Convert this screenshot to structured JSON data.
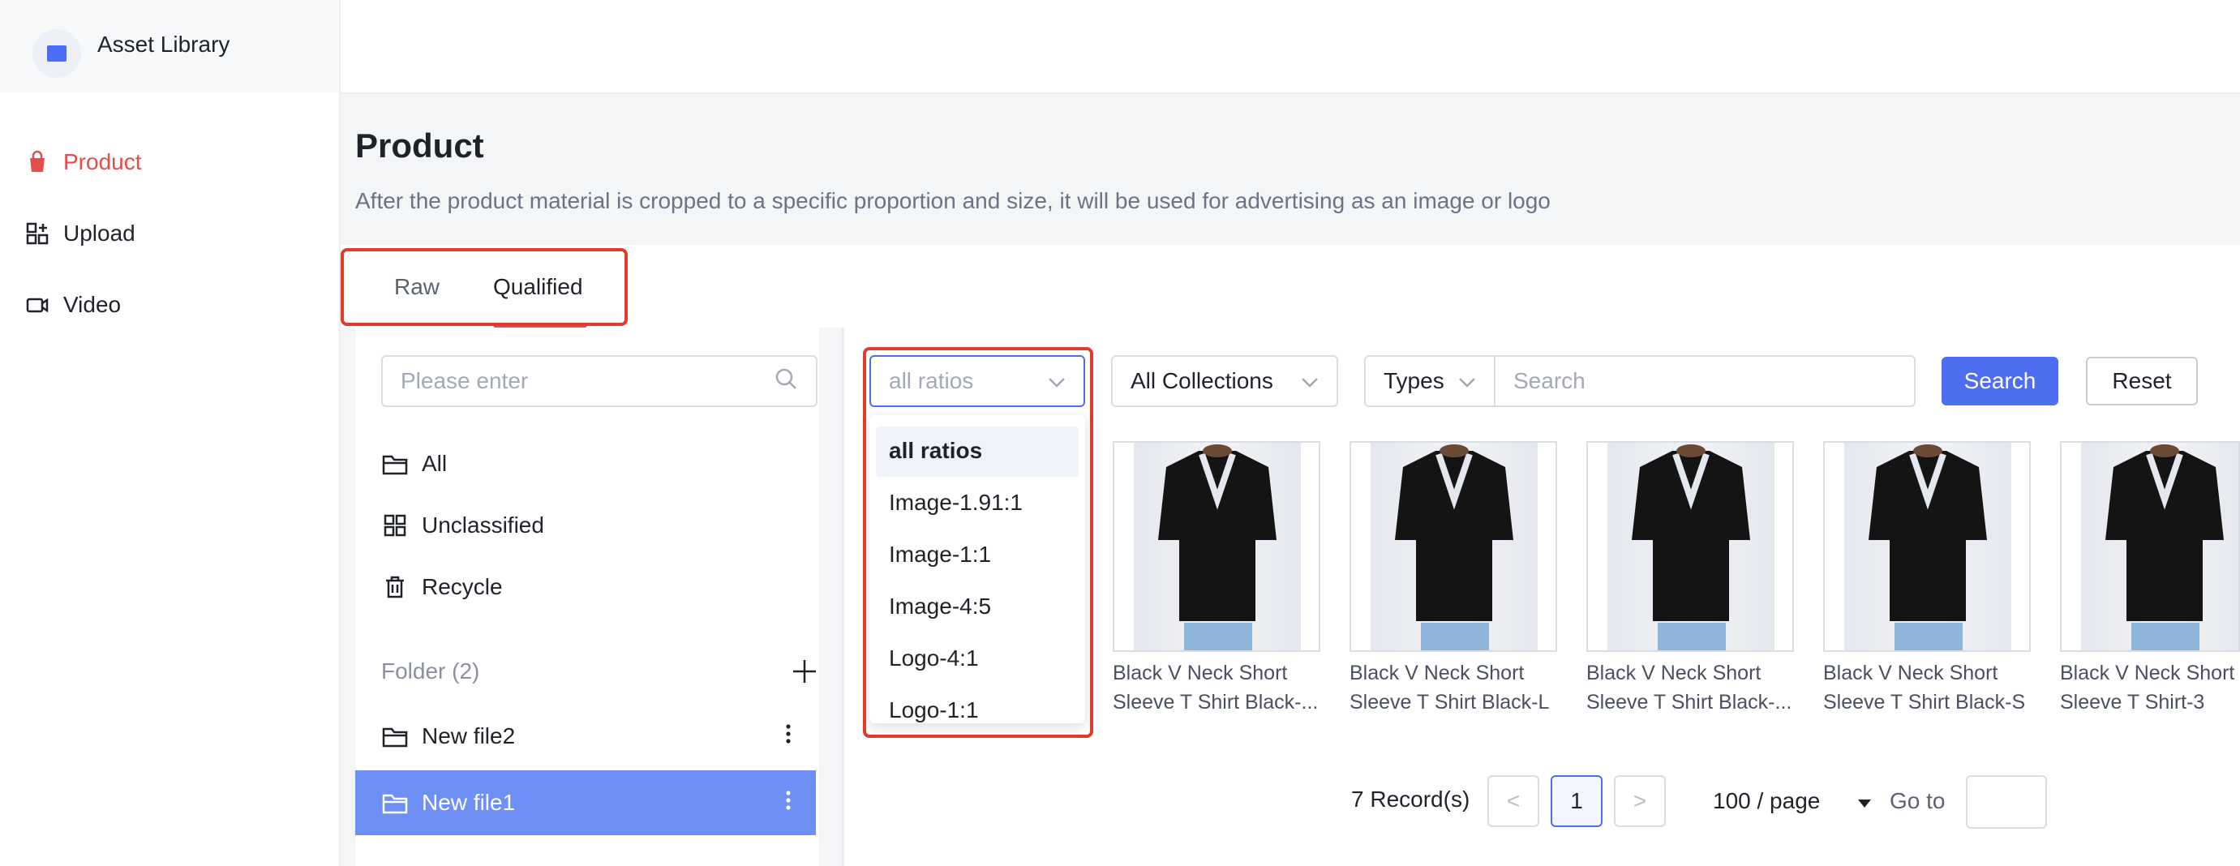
{
  "app": {
    "title": "Asset Library"
  },
  "sidebar": {
    "items": [
      {
        "label": "Product",
        "icon": "shopping-bag-icon",
        "active": true
      },
      {
        "label": "Upload",
        "icon": "upload-grid-icon",
        "active": false
      },
      {
        "label": "Video",
        "icon": "video-icon",
        "active": false
      }
    ]
  },
  "page": {
    "title": "Product",
    "description": "After the product material is cropped to a specific proportion and size, it will be used for advertising as an image or logo"
  },
  "tabs": [
    {
      "label": "Raw",
      "active": false
    },
    {
      "label": "Qualified",
      "active": true
    }
  ],
  "left_panel": {
    "search_placeholder": "Please enter",
    "tree": [
      {
        "label": "All",
        "icon": "folder-icon"
      },
      {
        "label": "Unclassified",
        "icon": "grid-icon"
      },
      {
        "label": "Recycle",
        "icon": "trash-icon"
      }
    ],
    "folder_header": "Folder (2)",
    "files": [
      {
        "label": "New file2",
        "selected": false
      },
      {
        "label": "New file1",
        "selected": true
      }
    ]
  },
  "filters": {
    "ratio_select": "all ratios",
    "ratio_options": [
      "all ratios",
      "Image-1.91:1",
      "Image-1:1",
      "Image-4:5",
      "Logo-4:1",
      "Logo-1:1"
    ],
    "collections_select": "All Collections",
    "types_select": "Types",
    "search_placeholder": "Search",
    "search_button": "Search",
    "reset_button": "Reset"
  },
  "assets": [
    {
      "caption_line1": "Black V Neck Short",
      "caption_line2": "Sleeve T Shirt Black-..."
    },
    {
      "caption_line1": "Black V Neck Short",
      "caption_line2": "Sleeve T Shirt Black-L"
    },
    {
      "caption_line1": "Black V Neck Short",
      "caption_line2": "Sleeve T Shirt Black-..."
    },
    {
      "caption_line1": "Black V Neck Short",
      "caption_line2": "Sleeve T Shirt Black-S"
    },
    {
      "caption_line1": "Black V Neck Short",
      "caption_line2": "Sleeve T Shirt-3"
    }
  ],
  "pagination": {
    "records": "7 Record(s)",
    "prev": "<",
    "current_page": "1",
    "next": ">",
    "page_size": "100 / page",
    "goto_label": "Go to"
  },
  "colors": {
    "accent": "#4e6ef2",
    "active_nav": "#e34d4d",
    "highlight_box": "#e03b2c",
    "selected_row": "#6e8ff5"
  }
}
